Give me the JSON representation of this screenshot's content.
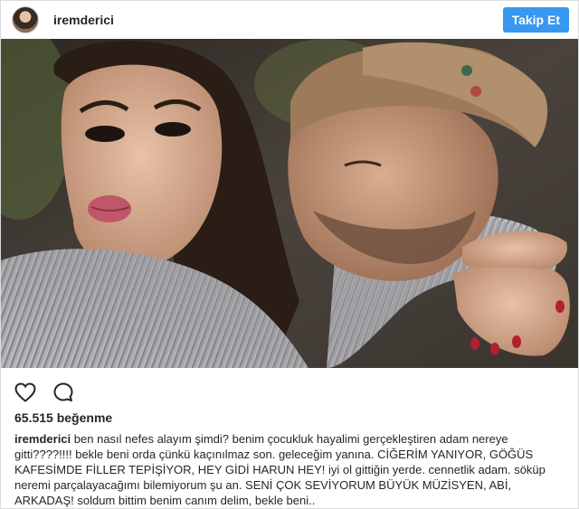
{
  "header": {
    "username": "iremderici",
    "follow_label": "Takip Et"
  },
  "photo": {
    "description_icon": "photo-image"
  },
  "actions": {
    "like_icon": "heart-icon",
    "comment_icon": "comment-icon"
  },
  "likes": {
    "count_text": "65.515 beğenme"
  },
  "caption": {
    "username": "iremderici",
    "text": "ben nasıl nefes alayım şimdi? benim çocukluk hayalimi gerçekleştiren adam nereye gitti????!!!! bekle beni orda çünkü kaçınılmaz son. geleceğim yanına. CİĞERİM YANIYOR, GÖĞÜS KAFESİMDE FİLLER TEPİŞİYOR, HEY GİDİ HARUN HEY! iyi ol gittiğin yerde. cennetlik adam. söküp neremi parçalayacağımı bilemiyorum şu an. SENİ ÇOK SEVİYORUM BÜYÜK MÜZİSYEN, ABİ, ARKADAŞ! soldum bittim benim canım delim, bekle beni.."
  },
  "colors": {
    "accent": "#3897f0",
    "text": "#262626",
    "border": "#dbdbdb"
  }
}
